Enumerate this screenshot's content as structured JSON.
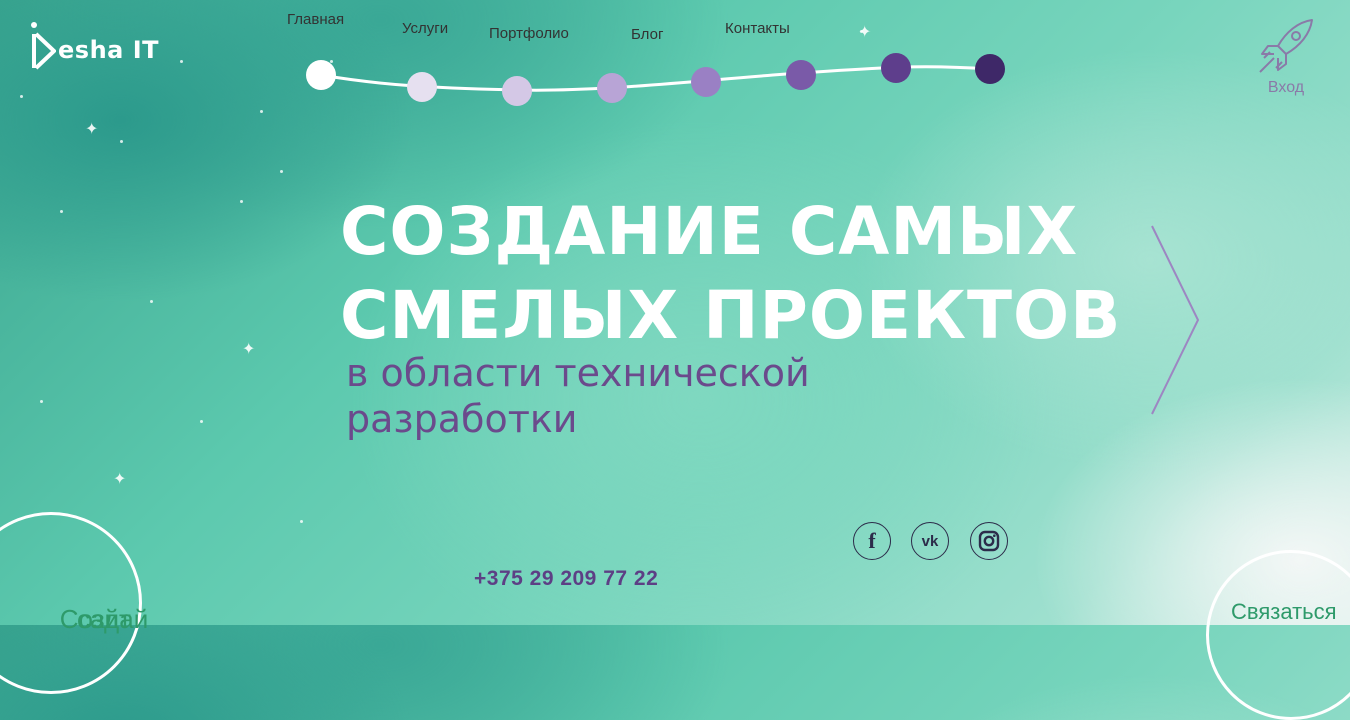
{
  "brand": {
    "name": "esha IT",
    "logo_letter": "D"
  },
  "nav": {
    "items": [
      {
        "label": "Главная",
        "active": true
      },
      {
        "label": "Услуги",
        "active": false
      },
      {
        "label": "Портфолио",
        "active": false
      },
      {
        "label": "Блог",
        "active": false
      },
      {
        "label": "Контакты",
        "active": false
      }
    ],
    "dot_colors": [
      "#ffffff",
      "#e6e0f0",
      "#d4c8e6",
      "#b8a4d6",
      "#9a80c4",
      "#7a5aa8",
      "#5e3e8c",
      "#3e2868"
    ]
  },
  "login": {
    "label": "Вход",
    "icon": "rocket-icon"
  },
  "hero": {
    "title_line1": "СОЗДАНИЕ САМЫХ",
    "title_line2": "СМЕЛЫХ ПРОЕКТОВ",
    "subtitle_line1": "в области технической",
    "subtitle_line2": "разработки"
  },
  "social": [
    {
      "icon": "facebook-icon",
      "glyph": "f"
    },
    {
      "icon": "vk-icon",
      "glyph": "vk"
    },
    {
      "icon": "instagram-icon",
      "glyph": ""
    }
  ],
  "contact": {
    "phone": "+375 29 209 77 22"
  },
  "cta": {
    "create_line1": "Создай",
    "create_line2": "сайт",
    "contact_label": "Связаться"
  },
  "colors": {
    "accent_purple": "#6b4a8c",
    "cta_green": "#2e9a6a",
    "text_dark": "#333333"
  }
}
